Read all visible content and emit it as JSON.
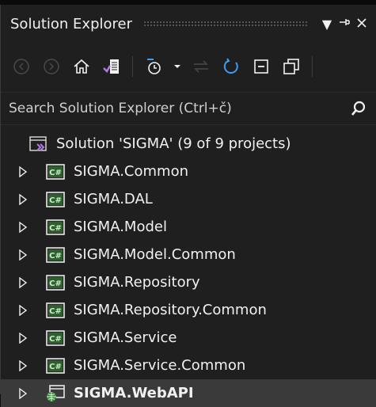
{
  "window": {
    "title": "Solution Explorer"
  },
  "search": {
    "placeholder": "Search Solution Explorer (Ctrl+č)"
  },
  "tree": {
    "solution_label": "Solution 'SIGMA' (9 of 9 projects)",
    "projects": [
      {
        "label": "SIGMA.Common",
        "icon": "csharp-project-icon"
      },
      {
        "label": "SIGMA.DAL",
        "icon": "csharp-project-icon"
      },
      {
        "label": "SIGMA.Model",
        "icon": "csharp-project-icon"
      },
      {
        "label": "SIGMA.Model.Common",
        "icon": "csharp-project-icon"
      },
      {
        "label": "SIGMA.Repository",
        "icon": "csharp-project-icon"
      },
      {
        "label": "SIGMA.Repository.Common",
        "icon": "csharp-project-icon"
      },
      {
        "label": "SIGMA.Service",
        "icon": "csharp-project-icon"
      },
      {
        "label": "SIGMA.Service.Common",
        "icon": "csharp-project-icon"
      },
      {
        "label": "SIGMA.WebAPI",
        "icon": "web-project-icon",
        "selected": true
      }
    ]
  },
  "colors": {
    "background": "#1f1f1f",
    "selected_row": "#3a3a3a",
    "accent_blue": "#3b9df3",
    "csharp_green": "#3c8d3c"
  }
}
